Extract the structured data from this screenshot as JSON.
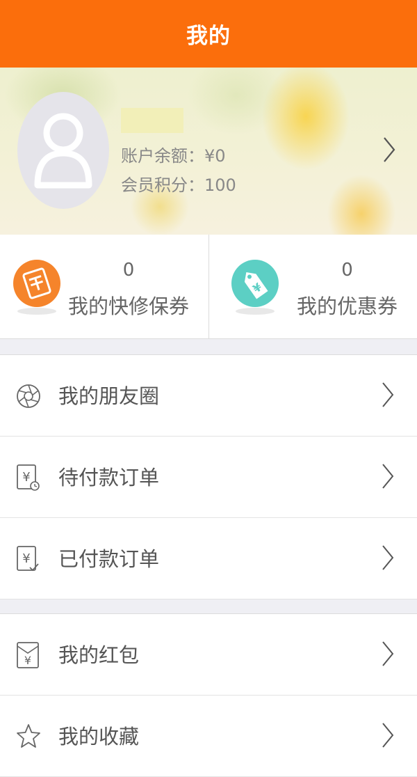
{
  "header": {
    "title": "我的"
  },
  "profile": {
    "balance": "账户余额：¥0",
    "points": "会员积分：100"
  },
  "tickets": [
    {
      "count": "0",
      "label": "我的快修保券",
      "icon": "repair-coupon-icon",
      "color": "#f5842b"
    },
    {
      "count": "0",
      "label": "我的优惠券",
      "icon": "discount-tag-icon",
      "color": "#5ccfc4"
    }
  ],
  "menu_group1": [
    {
      "label": "我的朋友圈",
      "icon": "aperture-icon"
    },
    {
      "label": "待付款订单",
      "icon": "pending-payment-icon"
    },
    {
      "label": "已付款订单",
      "icon": "paid-order-icon"
    }
  ],
  "menu_group2": [
    {
      "label": "我的红包",
      "icon": "red-envelope-icon"
    },
    {
      "label": "我的收藏",
      "icon": "star-icon"
    }
  ]
}
